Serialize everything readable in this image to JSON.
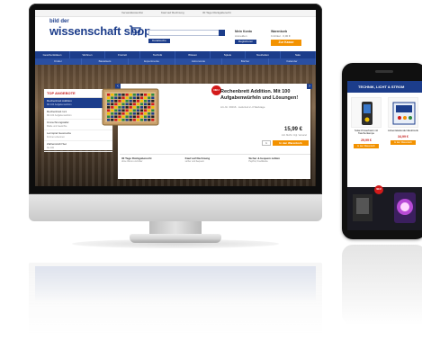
{
  "shop": {
    "topbar": [
      "Versandkostenfrei",
      "Kauf auf Rechnung",
      "30 Tage Rückgaberecht"
    ],
    "logo_small": "bild der",
    "logo_big": "wissenschaft shop",
    "search_placeholder": "Suche",
    "advanced_search": "Detailsuche",
    "account_title": "Mein Konto",
    "account_sub": "Anmelden",
    "account_button": "Registrieren",
    "cart_title": "Warenkorb",
    "cart_sub": "0 Artikel · 0,00 €",
    "cart_button": "Zur Kasse",
    "nav1": [
      "Geschenkideen",
      "Wohnen",
      "Freizeit",
      "Technik",
      "Wissen",
      "Spiele",
      "Neuheiten",
      "Sale"
    ],
    "nav2": [
      "Kinder",
      "Bastelsets",
      "Experimente",
      "Astronomie",
      "Bücher",
      "Kalender"
    ]
  },
  "sidebar": {
    "title": "TOP ANGEBOTE",
    "items": [
      {
        "label": "Rechenbrett Addition",
        "sub": "Mit 100 Aufgabenwürfeln"
      },
      {
        "label": "Rechenbrett 1x1",
        "sub": "Mit 100 Aufgabenwürfeln"
      },
      {
        "label": "Umrechnungstafel",
        "sub": "Maße und Gewichte"
      },
      {
        "label": "Lernspiel Geometrie",
        "sub": "Formen erkennen"
      },
      {
        "label": "Zahlenstrahl Set",
        "sub": "bis 100"
      }
    ]
  },
  "product": {
    "badge": "NEU",
    "title": "Rechenbrett Addition. Mit 100 Aufgabenwürfeln und Lösungen!",
    "sub": "Art.-Nr. 36016 · Lieferzeit 2–3 Werktage",
    "price": "15,99 €",
    "vat": "inkl. MwSt. zzgl. Versand",
    "qty": "1",
    "add_to_cart": "In den Warenkorb",
    "features": [
      {
        "title": "30 Tage Rückgaberecht",
        "sub": "ohne Wenn und Aber"
      },
      {
        "title": "Kauf auf Rechnung",
        "sub": "sicher und bequem"
      },
      {
        "title": "Sicher & bequem zahlen",
        "sub": "PayPal, Kreditkarte"
      }
    ]
  },
  "phone": {
    "header": "TECHNIK, LICHT & STROM",
    "products": [
      {
        "name": "Solar-Powerbank mit Taschenlampe",
        "price": "29,99 €",
        "button": "In den Warenkorb"
      },
      {
        "name": "Adventskalender Elektronik",
        "price": "34,99 €",
        "button": "In den Warenkorb"
      }
    ],
    "badge": "NEU"
  },
  "colors": {
    "brand_blue": "#1c3d8b",
    "accent_orange": "#f39200",
    "sale_red": "#d31a1a"
  }
}
